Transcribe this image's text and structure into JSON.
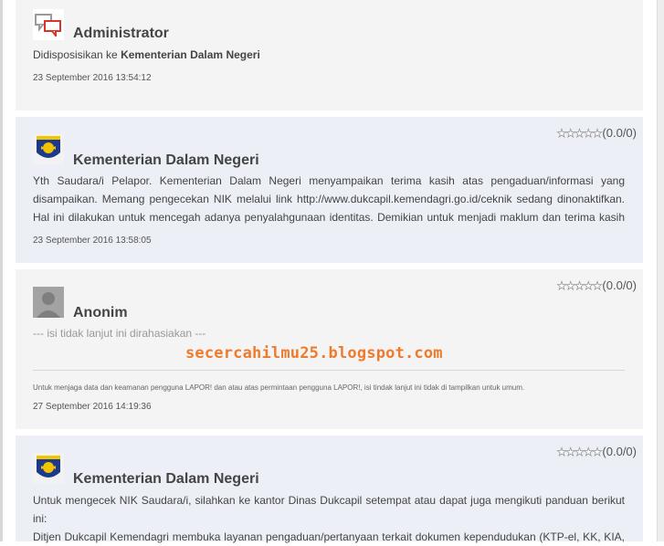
{
  "colors": {
    "card_bg": "#f4f4f4",
    "gov_card_bg": "#eceff5",
    "watermark": "#f07a2c"
  },
  "comments": [
    {
      "avatar_icon": "chat-bubbles-icon",
      "author": "Administrator",
      "text_prefix": "Didisposisikan ke",
      "text_target": "Kementerian Dalam Negeri",
      "timestamp": "23 September 2016 13:54:12"
    },
    {
      "avatar_icon": "garuda-emblem-icon",
      "author": "Kementerian Dalam Negeri",
      "rating": "(0.0/0)",
      "stars": 0,
      "lines": [
        "Yth Saudara/i Pelapor. Kementerian Dalam Negeri menyampaikan terima kasih atas pengaduan/informasi yang",
        "disampaikan. Memang pengecekan NIK melalui link http://www.dukcapil.kemendagri.go.id/ceknik sedang dinonaktifkan.",
        "Hal ini dilakukan untuk mencegah adanya penyalahgunaan identitas. Demikian untuk menjadi maklum dan terima kasih"
      ],
      "timestamp": "23 September 2016 13:58:05"
    },
    {
      "avatar_icon": "anonymous-user-icon",
      "author": "Anonim",
      "rating": "(0.0/0)",
      "stars": 0,
      "hidden_text": "--- isi tidak lanjut ini dirahasiakan ---",
      "note": "Untuk menjaga data dan keamanan pengguna LAPOR! dan atau atas permintaan pengguna LAPOR!, isi tindak lanjut ini tidak di tampilkan untuk umum.",
      "timestamp": "27 September 2016 14:19:36"
    },
    {
      "avatar_icon": "garuda-emblem-icon",
      "author": "Kementerian Dalam Negeri",
      "rating": "(0.0/0)",
      "stars": 0,
      "lines": [
        "Untuk mengecek NIK Saudara/i, silahkan ke kantor Dinas Dukcapil setempat atau dapat juga mengikuti panduan berikut",
        "ini:",
        "Ditjen Dukcapil Kemendagri membuka layanan pengaduan/pertanyaan terkait dokumen kependudukan (KTP-el, KK, KIA,"
      ]
    }
  ],
  "watermark": "secercahilmu25.blogspot.com"
}
